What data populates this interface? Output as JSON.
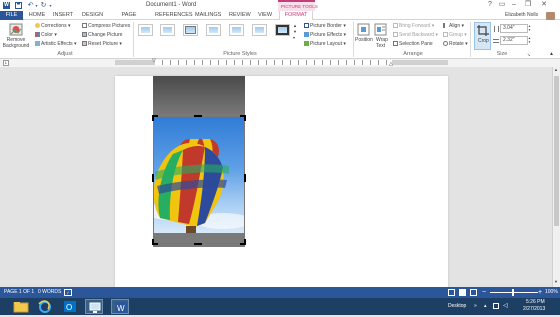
{
  "window": {
    "title": "Document1 - Word",
    "contextual_tab_label": "PICTURE TOOLS",
    "user_name": "Elizabeth Nolls",
    "help_label": "?"
  },
  "tabs": [
    "FILE",
    "HOME",
    "INSERT",
    "DESIGN",
    "PAGE LAYOUT",
    "REFERENCES",
    "MAILINGS",
    "REVIEW",
    "VIEW",
    "FORMAT"
  ],
  "active_tab": "FORMAT",
  "ribbon": {
    "adjust": {
      "remove_background": "Remove Background",
      "corrections": "Corrections",
      "color": "Color",
      "artistic_effects": "Artistic Effects",
      "compress_pictures": "Compress Pictures",
      "change_picture": "Change Picture",
      "reset_picture": "Reset Picture",
      "group_label": "Adjust"
    },
    "picture_styles": {
      "border": "Picture Border",
      "effects": "Picture Effects",
      "layout": "Picture Layout",
      "group_label": "Picture Styles"
    },
    "arrange": {
      "position": "Position",
      "wrap_text": "Wrap Text",
      "bring_forward": "Bring Forward",
      "send_backward": "Send Backward",
      "selection_pane": "Selection Pane",
      "align": "Align",
      "group": "Group",
      "rotate": "Rotate",
      "group_label": "Arrange"
    },
    "size": {
      "crop": "Crop",
      "height": "3.04\"",
      "width": "2.32\"",
      "group_label": "Size"
    }
  },
  "status": {
    "page": "PAGE 1 OF 1",
    "words": "0 WORDS",
    "zoom": "100%"
  },
  "taskbar": {
    "desktop_label": "Desktop",
    "time": "5:26 PM",
    "date": "2/27/2013"
  },
  "colors": {
    "word_blue": "#2b579a",
    "contextual_pink": "#c43e7b",
    "taskbar": "#1c3f63"
  }
}
